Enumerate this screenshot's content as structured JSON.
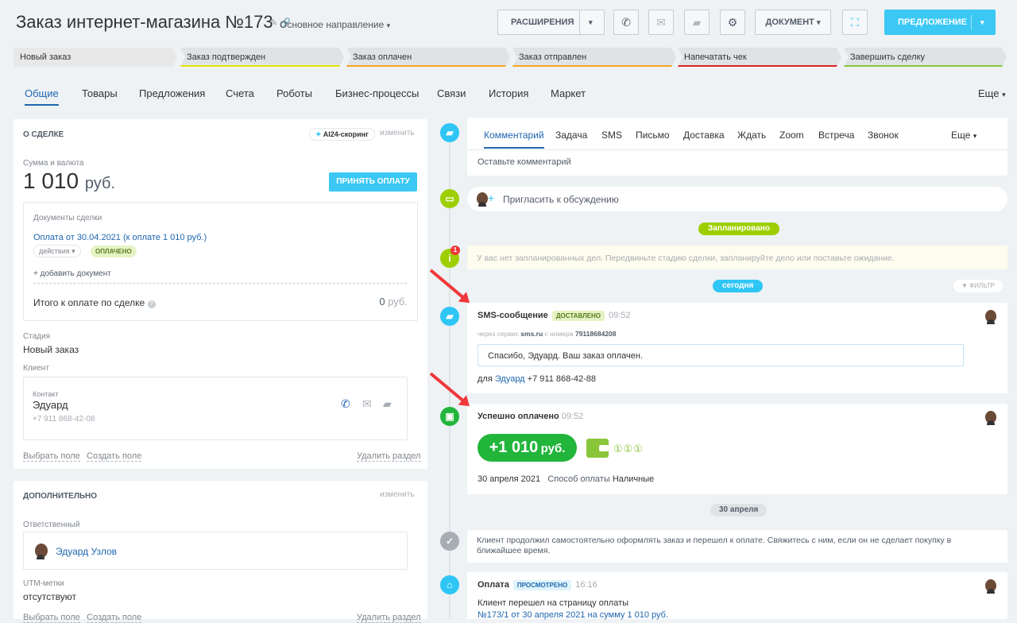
{
  "header": {
    "title": "Заказ интернет-магазина",
    "number": "№173",
    "direction": "Основное направление",
    "extensions_label": "РАСШИРЕНИЯ",
    "document_label": "ДОКУМЕНТ",
    "offer_label": "ПРЕДЛОЖЕНИЕ"
  },
  "stages": [
    {
      "label": "Новый заказ",
      "color": "#e8e8e8",
      "line": "#e8e8e8"
    },
    {
      "label": "Заказ подтвержден",
      "color": "#dfe3e6",
      "line": "#e8e300"
    },
    {
      "label": "Заказ оплачен",
      "color": "#dfe3e6",
      "line": "#f5a623"
    },
    {
      "label": "Заказ отправлен",
      "color": "#dfe3e6",
      "line": "#f5a623"
    },
    {
      "label": "Напечатать чек",
      "color": "#dfe3e6",
      "line": "#e02020"
    },
    {
      "label": "Завершить сделку",
      "color": "#dfe3e6",
      "line": "#8ac63a"
    }
  ],
  "tabs": [
    "Общие",
    "Товары",
    "Предложения",
    "Счета",
    "Роботы",
    "Бизнес-процессы",
    "Связи",
    "История",
    "Маркет"
  ],
  "tabs_more": "Еще",
  "deal": {
    "title": "О СДЕЛКЕ",
    "scoring": "AI24-скоринг",
    "edit": "изменить",
    "sum_label": "Сумма и валюта",
    "sum": "1 010",
    "currency": "руб.",
    "pay_button": "ПРИНЯТЬ ОПЛАТУ",
    "docs_label": "Документы сделки",
    "doc_link": "Оплата от 30.04.2021 (к оплате 1 010 руб.)",
    "doc_actions": "действия",
    "doc_status": "ОПЛАЧЕНО",
    "add_doc": "+ добавить документ",
    "total_label": "Итого к оплате по сделке",
    "total_value": "0",
    "total_currency": "руб.",
    "stage_label": "Стадия",
    "stage_value": "Новый заказ",
    "client_label": "Клиент",
    "contact_label": "Контакт",
    "contact_name": "Эдуард",
    "contact_phone": "+7 911 868-42-08",
    "choose_field": "Выбрать поле",
    "create_field": "Создать поле",
    "delete_section": "Удалить раздел"
  },
  "extra": {
    "title": "ДОПОЛНИТЕЛЬНО",
    "edit": "изменить",
    "responsible_label": "Ответственный",
    "responsible_name": "Эдуард Узлов",
    "utm_label": "UTM-метки",
    "utm_value": "отсутствуют",
    "choose_field": "Выбрать поле",
    "create_field": "Создать поле",
    "delete_section": "Удалить раздел"
  },
  "activity": {
    "tabs": [
      "Комментарий",
      "Задача",
      "SMS",
      "Письмо",
      "Доставка",
      "Ждать",
      "Zoom",
      "Встреча",
      "Звонок"
    ],
    "more": "Еще",
    "placeholder": "Оставьте комментарий",
    "invite": "Пригласить к обсуждению",
    "planned": "Запланировано",
    "empty_notice": "У вас нет запланированных дел. Передвиньте стадию сделки, запланируйте дело или поставьте ожидание.",
    "today": "сегодня",
    "filter": "ФИЛЬТР",
    "notice_count": "1"
  },
  "sms": {
    "title": "SMS-сообщение",
    "status": "ДОСТАВЛЕНО",
    "time": "09:52",
    "via_prefix": "через сервис",
    "via_service": "sms.ru",
    "via_mid": "с номера",
    "via_number": "79118684208",
    "message": "Спасибо, Эдуард. Ваш заказ оплачен.",
    "to_prefix": "для",
    "to_name": "Эдуард",
    "to_phone": "+7 911 868-42-88"
  },
  "payment": {
    "title": "Успешно оплачено",
    "time": "09:52",
    "amount": "+1 010",
    "currency": "руб.",
    "date": "30 апреля 2021",
    "method_label": "Способ оплаты",
    "method": "Наличные"
  },
  "date_separator": "30 апреля",
  "client_notice": "Клиент продолжил самостоятельно оформлять заказ и перешел к оплате. Свяжитесь с ним, если он не сделает покупку в ближайшее время.",
  "visit": {
    "title": "Оплата",
    "status": "ПРОСМОТРЕНО",
    "time": "16:16",
    "text": "Клиент перешел на страницу оплаты",
    "link": "№173/1 от 30 апреля 2021 на сумму 1 010 руб."
  },
  "colors": {
    "accent": "#3bc8f5",
    "link": "#2067b0",
    "green": "#22b53b",
    "lime": "#9dcf00"
  }
}
